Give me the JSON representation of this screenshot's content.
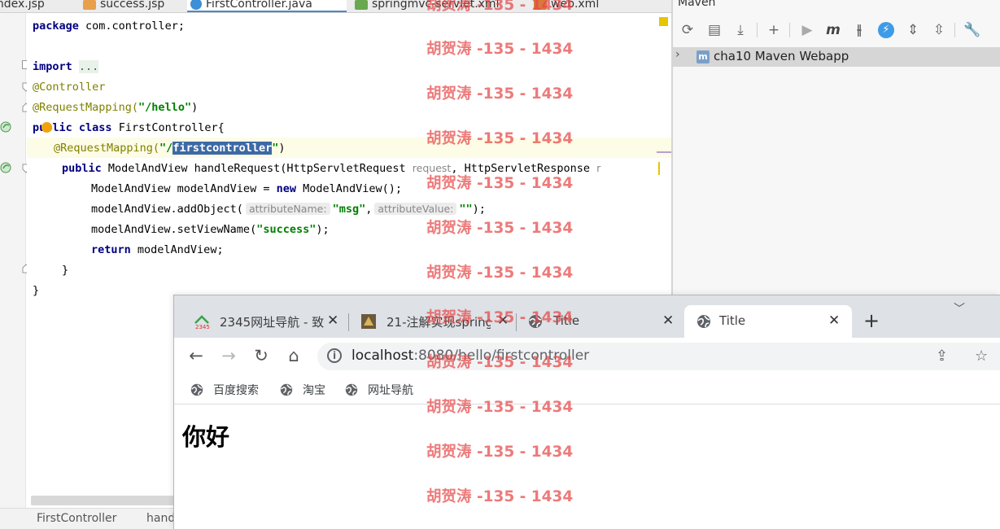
{
  "ide": {
    "tabs": [
      {
        "label": "index.jsp"
      },
      {
        "label": "success.jsp"
      },
      {
        "label": "FirstController.java"
      },
      {
        "label": "springmvc-servlet.xml"
      },
      {
        "label": "web.xml"
      }
    ],
    "code": {
      "l1_kw": "package",
      "l1_rest": " com.controller;",
      "l2_kw": "import",
      "l2_fold": "...",
      "l3_ann": "@Controller",
      "l4_ann": "@RequestMapping(",
      "l4_str": "\"/hello\"",
      "l4_end": ")",
      "l5_kw1": "public",
      "l5_kw2": "class",
      "l5_rest": " FirstController{",
      "l6_ann": "@RequestMapping(",
      "l6_str1": "\"/",
      "l6_sel": "firstcontroller",
      "l6_str2": "\"",
      "l6_end": ")",
      "l7_kw": "public",
      "l7_rest": " ModelAndView handleRequest(HttpServletRequest ",
      "l7_p1": "request",
      "l7_mid": ", HttpServletResponse ",
      "l7_p2": "r",
      "l8_a": "ModelAndView modelAndView = ",
      "l8_kw": "new",
      "l8_b": " ModelAndView();",
      "l9_a": "modelAndView.addObject(",
      "l9_h1": "attributeName:",
      "l9_s1": "\"msg\"",
      "l9_comma": ",",
      "l9_h2": "attributeValue:",
      "l9_s2": "\"\"",
      "l9_end": ");",
      "l10_a": "modelAndView.setViewName(",
      "l10_s": "\"success\"",
      "l10_end": ");",
      "l11_kw": "return",
      "l11_rest": " modelAndView;",
      "l12": "}",
      "l13": "}"
    },
    "breadcrumb": [
      "FirstController",
      "hand"
    ]
  },
  "maven": {
    "title": "Maven",
    "project": "cha10 Maven Webapp"
  },
  "browser": {
    "tabs": [
      {
        "label": "2345网址导航 - 致"
      },
      {
        "label": "21-注解实现spring"
      },
      {
        "label": "Title"
      },
      {
        "label": "Title"
      }
    ],
    "url_host": "localhost",
    "url_rest": ":8080/hello/firstcontroller",
    "bookmarks": [
      {
        "label": "百度搜索"
      },
      {
        "label": "淘宝"
      },
      {
        "label": "网址导航"
      }
    ],
    "page_text": "你好"
  },
  "watermark": "胡贺涛 -135 - 1434",
  "colors": {
    "keyword": "#000080",
    "annotation": "#808000",
    "string": "#008000",
    "selection": "#3d6aa6",
    "watermark": "#e64646"
  }
}
